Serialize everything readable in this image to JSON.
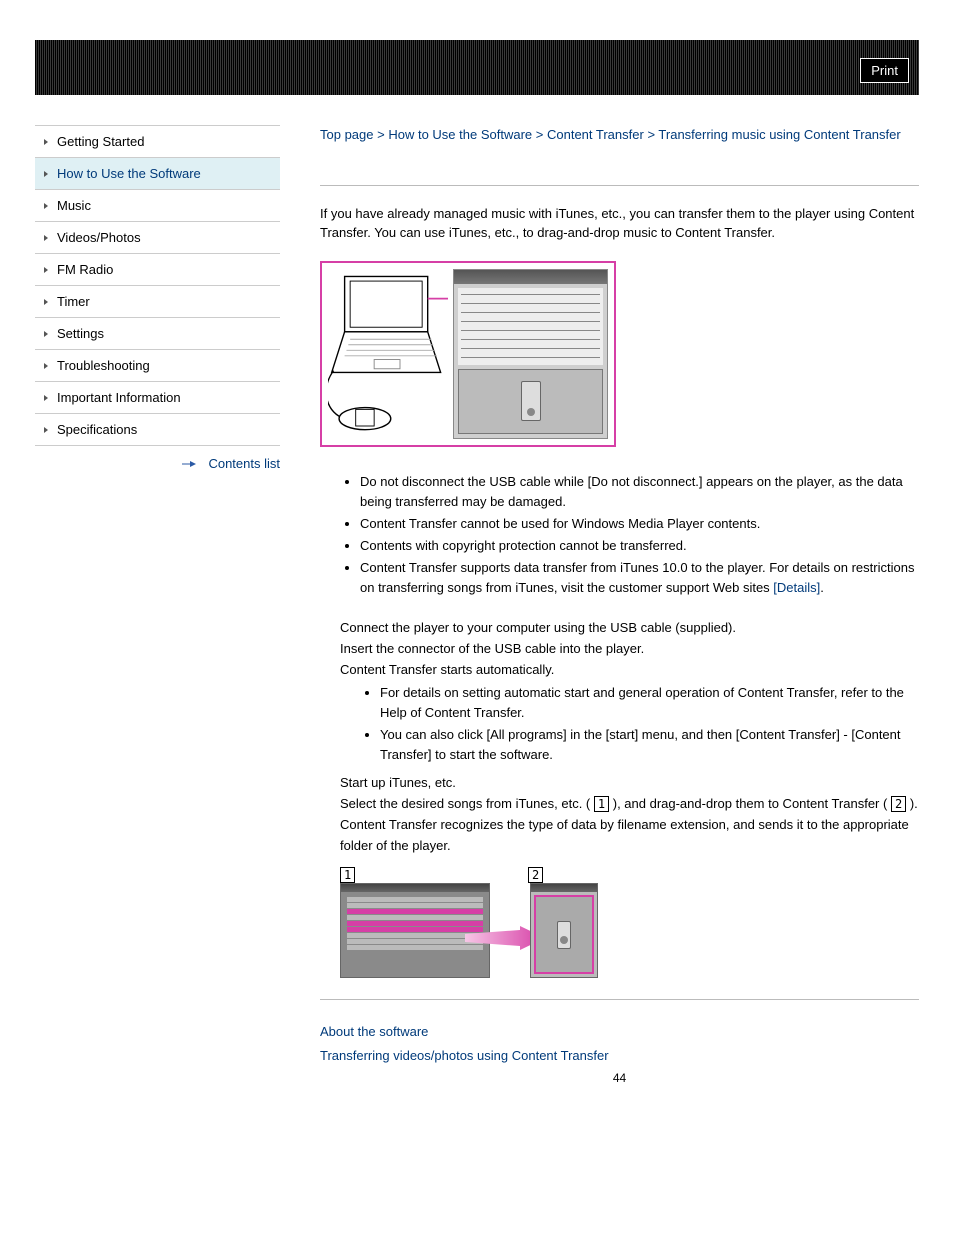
{
  "header": {
    "print": "Print"
  },
  "breadcrumb": {
    "top": "Top page",
    "sep": ">",
    "l1": "How to Use the Software",
    "l2": "Content Transfer",
    "current": "Transferring music using Content Transfer"
  },
  "sidebar": {
    "items": [
      "Getting Started",
      "How to Use the Software",
      "Music",
      "Videos/Photos",
      "FM Radio",
      "Timer",
      "Settings",
      "Troubleshooting",
      "Important Information",
      "Specifications"
    ],
    "active_index": 1,
    "contents_list": "Contents list"
  },
  "intro": "If you have already managed music with iTunes, etc., you can transfer them to the player using Content Transfer. You can use iTunes, etc., to drag-and-drop music to Content Transfer.",
  "notes": [
    "Do not disconnect the USB cable while [Do not disconnect.] appears on the player, as the data being transferred may be damaged.",
    "Content Transfer cannot be used for Windows Media Player contents.",
    "Contents with copyright protection cannot be transferred.",
    "Content Transfer supports data transfer from iTunes 10.0 to the player. For details on restrictions on transferring songs from iTunes, visit the customer support Web sites "
  ],
  "details_link": "[Details]",
  "steps": {
    "s1a": "Connect the player to your computer using the USB cable (supplied).",
    "s1b": "Insert the connector of the USB cable into the player.",
    "s1c": "Content Transfer starts automatically.",
    "sub": [
      "For details on setting automatic start and general operation of Content Transfer, refer to the Help of Content Transfer.",
      "You can also click [All programs] in the [start] menu, and then [Content Transfer] - [Content Transfer] to start the software."
    ],
    "s2": "Start up iTunes, etc.",
    "s3a": "Select the desired songs from iTunes, etc. (",
    "s3b": "), and drag-and-drop them to Content Transfer (",
    "s3c": ").",
    "s3d": "Content Transfer recognizes the type of data by filename extension, and sends it to the appropriate folder of the player."
  },
  "markers": {
    "one": "1",
    "two": "2"
  },
  "related": {
    "r1": "About the software",
    "r2": "Transferring videos/photos using Content Transfer"
  },
  "page_number": "44"
}
